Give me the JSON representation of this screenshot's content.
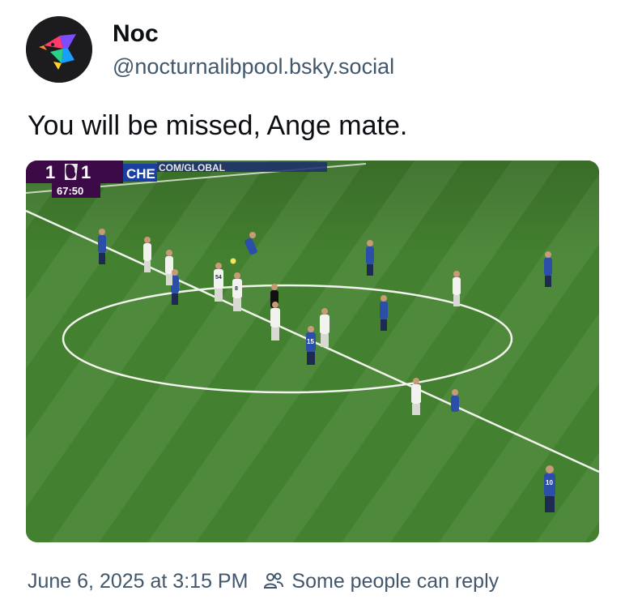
{
  "author": {
    "display_name": "Noc",
    "handle": "@nocturnalibpool.bsky.social",
    "avatar_icon": "colorful-bird-avatar"
  },
  "post": {
    "text": "You will be missed, Ange mate."
  },
  "media": {
    "scoreboard": {
      "home_score": "1",
      "separator": "-",
      "away_score": "1",
      "away_team": "CHE",
      "clock": "67:50",
      "ticker_text": "COM/GLOBAL"
    },
    "shirt_numbers": [
      "54",
      "8",
      "15",
      "10"
    ]
  },
  "footer": {
    "timestamp": "June 6, 2025 at 3:15 PM",
    "reply_setting": "Some people can reply",
    "reply_icon": "people-icon"
  },
  "colors": {
    "pitch_light": "#4f8a3c",
    "pitch_dark": "#3c7330",
    "away_kit": "#2b4fa8",
    "home_kit": "#f2f2ee",
    "scoreboard_purple": "#3b0a47",
    "scoreboard_blue": "#1b3fa0",
    "muted_text": "#42576c"
  }
}
